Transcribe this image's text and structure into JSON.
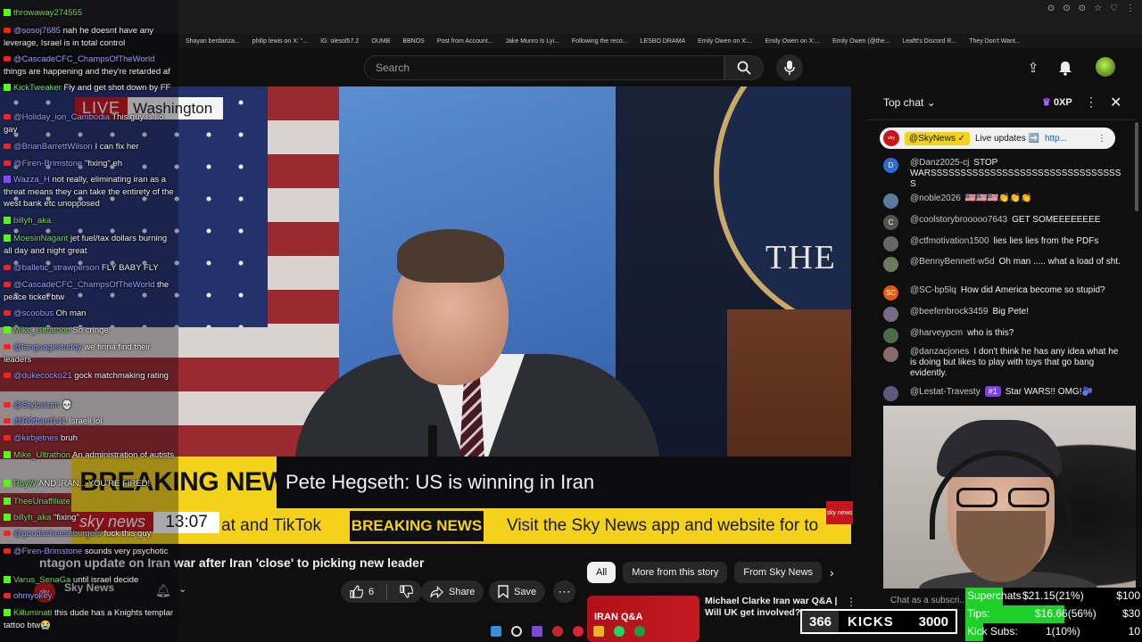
{
  "bookmarks": [
    "Shayan berdariza...",
    "philip lewis on X: \"...",
    "IG: olesol57.2",
    "OUMB",
    "BBNOS",
    "Post from Account...",
    "Jake Munro Is Lyi...",
    "Following the reco...",
    "LESBO DRAMA",
    "Emily Owen on X:...",
    "Emily Owen on X:...",
    "Emily Owen (@the...",
    "Leaftt's Discord R...",
    "They Don't Want..."
  ],
  "search": {
    "placeholder": "Search"
  },
  "video": {
    "live_label": "LIVE",
    "location": "Washington",
    "seal_text": "THE",
    "breaking_label": "BREAKING NEWS",
    "headline": "Pete Hegseth: US is winning in Iran",
    "ticker_brand": "sky news",
    "ticker_time": "13:07",
    "ticker_text_1": "at and TikTok",
    "ticker_breaking": "BREAKING NEWS",
    "ticker_text_2": "Visit the Sky News app and website for to",
    "corner_logo": "sky news"
  },
  "below_video": {
    "title": "ntagon update on Iran war after Iran 'close' to picking new leader",
    "channel_name": "Sky News",
    "channel_subs": "",
    "like_count": "6",
    "share_label": "Share",
    "save_label": "Save",
    "chips": [
      "All",
      "More from this story",
      "From Sky News"
    ],
    "rec_thumb_text": "IRAN Q&A",
    "rec_title": "Michael Clarke Iran war Q&A | Will UK get involved? W..."
  },
  "left_chat": [
    {
      "badge": "k",
      "user": "throwaway274555",
      "text": ""
    },
    {
      "badge": "y",
      "user": "@sosoj7685",
      "text": "nah he doesnt have any leverage, Israel is in total control"
    },
    {
      "badge": "y",
      "user": "@CascadeCFC_ChampsOfTheWorld",
      "text": "things are happening and they're retarded af"
    },
    {
      "badge": "k",
      "user": "KickTweaker",
      "text": "Fly and get shot down by FF"
    },
    {
      "badge": "y",
      "user": "@Holiday_ion_Cambodia",
      "text": "This guy is so gay"
    },
    {
      "badge": "y",
      "user": "@BrianBarrettWilson",
      "text": "I can fix her"
    },
    {
      "badge": "y",
      "user": "@Firen-Brimstone",
      "text": "\"fixing\" eh"
    },
    {
      "badge": "tw",
      "user": "Wazza_H",
      "text": "not really, eliminating iran as a threat means they can take the entirety of the west bank etc unopposed"
    },
    {
      "badge": "k",
      "user": "billyh_aka",
      "text": ""
    },
    {
      "badge": "k",
      "user": "MoesinNagant",
      "text": "jet fuel/tax dollars burning all day and night great"
    },
    {
      "badge": "y",
      "user": "@balletic_strawperson",
      "text": "FLY BABY FLY"
    },
    {
      "badge": "y",
      "user": "@CascadeCFC_ChampsOfTheWorld",
      "text": "the peace ticket btw"
    },
    {
      "badge": "y",
      "user": "@scoobus",
      "text": "Oh man"
    },
    {
      "badge": "k",
      "user": "Mike_Ultrathon",
      "text": "So cringe"
    },
    {
      "badge": "y",
      "user": "@languagestuddy",
      "text": "we finna find their leaders"
    },
    {
      "badge": "y",
      "user": "@dukecocko21",
      "text": "gock matchmaking rating"
    },
    {
      "badge": "y",
      "user": "@Stylonium",
      "text": "💀"
    },
    {
      "badge": "y",
      "user": "@R0tbard141",
      "text": "Israeli lol"
    },
    {
      "badge": "y",
      "user": "@kirbjetnes",
      "text": "bruh"
    },
    {
      "badge": "k",
      "user": "Mike_Ultrathon",
      "text": "An administration of autists"
    },
    {
      "badge": "k",
      "user": "RoyW",
      "text": "AND IRAN... YOU'RE FIRED!"
    },
    {
      "badge": "k",
      "user": "TheeUnaffiliate",
      "text": ""
    },
    {
      "badge": "k",
      "user": "billyh_aka",
      "text": "\"fixing\""
    },
    {
      "badge": "y",
      "user": "@goudacheeseburgers",
      "text": "fuck this guy"
    },
    {
      "badge": "y",
      "user": "@Firen-Brimstone",
      "text": "sounds very psychotic"
    },
    {
      "badge": "k",
      "user": "Varus_SenaGa",
      "text": "until israel decide"
    },
    {
      "badge": "y",
      "user": "ohmyokey",
      "text": ""
    },
    {
      "badge": "k",
      "user": "Killuminati",
      "text": "this dude has a Knights templar tattoo btw😭"
    }
  ],
  "live_chat": {
    "title": "Top chat",
    "xp": "0XP",
    "pinned": {
      "name": "@SkyNews ✓",
      "text": "Live updates ➡️",
      "link": "http..."
    },
    "messages": [
      {
        "avatar": "D",
        "color": "#2e6bd6",
        "name": "@Danz2025-cj",
        "text": "STOP WARSSSSSSSSSSSSSSSSSSSSSSSSSSSSSSSS S"
      },
      {
        "avatar": "",
        "color": "#5a7aa0",
        "name": "@noble2026",
        "text": "🇺🇸🇺🇸🇺🇸👏👏👏"
      },
      {
        "avatar": "C",
        "color": "#555",
        "name": "@coolstorybrooooo7643",
        "text": "GET SOMEEEEEEEE"
      },
      {
        "avatar": "",
        "color": "#666",
        "name": "@ctfmotivation1500",
        "text": "lies lies lies from the PDFs"
      },
      {
        "avatar": "",
        "color": "#6a7a5a",
        "name": "@BennyBennett-w5d",
        "text": "Oh man ..... what a load of sht."
      },
      {
        "avatar": "SC",
        "color": "#e05a10",
        "name": "@SC-bp5lq",
        "text": "How did America become so stupid?"
      },
      {
        "avatar": "",
        "color": "#7a6a8a",
        "name": "@beefenbrock3459",
        "text": "Big Pete!"
      },
      {
        "avatar": "",
        "color": "#4a6a4a",
        "name": "@harveypcm",
        "text": "who is this?"
      },
      {
        "avatar": "",
        "color": "#8a6a6a",
        "name": "@danzacjones",
        "text": "I don't think he has any idea what he is doing but likes to play with toys that go bang evidently."
      },
      {
        "avatar": "",
        "color": "#5a5a7a",
        "name": "@Lestat-Travesty",
        "badge": "#1",
        "text": "Star WARS!! OMG!🫐"
      }
    ],
    "input_hint": "Chat as a subscri..."
  },
  "stats": {
    "superchats": {
      "label": "Superchats",
      "value": "$21.15(21%)",
      "goal": "$100",
      "fraction": 0.21
    },
    "tips": {
      "label": "Tips:",
      "value": "$16.66(56%)",
      "goal": "$30",
      "fraction": 0.56
    },
    "subs": {
      "label": "Kick Subs:",
      "value": "1(10%)",
      "goal": "10",
      "fraction": 0.1
    }
  },
  "kicks": {
    "current": "366",
    "label": "KICKS",
    "goal": "3000"
  }
}
